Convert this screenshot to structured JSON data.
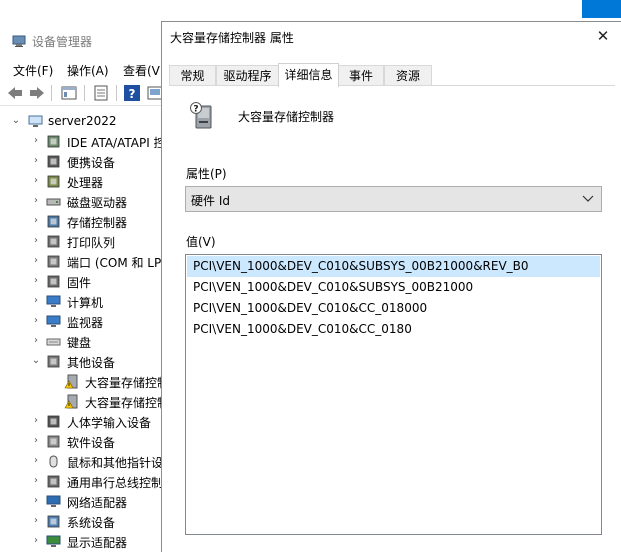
{
  "device_manager": {
    "title": "设备管理器",
    "menu": [
      "文件(F)",
      "操作(A)",
      "查看(V"
    ],
    "tree": {
      "root": "server2022",
      "items": [
        {
          "label": "IDE ATA/ATAPI 控",
          "icon": "ide-controller-icon",
          "expanded": false
        },
        {
          "label": "便携设备",
          "icon": "portable-device-icon",
          "expanded": false
        },
        {
          "label": "处理器",
          "icon": "processor-icon",
          "expanded": false
        },
        {
          "label": "磁盘驱动器",
          "icon": "disk-drive-icon",
          "expanded": false
        },
        {
          "label": "存储控制器",
          "icon": "storage-controller-icon",
          "expanded": false
        },
        {
          "label": "打印队列",
          "icon": "printer-icon",
          "expanded": false
        },
        {
          "label": "端口 (COM 和 LP",
          "icon": "port-icon",
          "expanded": false
        },
        {
          "label": "固件",
          "icon": "firmware-icon",
          "expanded": false
        },
        {
          "label": "计算机",
          "icon": "computer-icon",
          "expanded": false
        },
        {
          "label": "监视器",
          "icon": "monitor-icon",
          "expanded": false
        },
        {
          "label": "键盘",
          "icon": "keyboard-icon",
          "expanded": false
        },
        {
          "label": "其他设备",
          "icon": "other-devices-icon",
          "expanded": true
        },
        {
          "label": "大容量存储控制器",
          "icon": "warning-device-icon",
          "child": true
        },
        {
          "label": "大容量存储控制器",
          "icon": "warning-device-icon",
          "child": true
        },
        {
          "label": "人体学输入设备",
          "icon": "hid-icon",
          "expanded": false
        },
        {
          "label": "软件设备",
          "icon": "software-device-icon",
          "expanded": false
        },
        {
          "label": "鼠标和其他指针设",
          "icon": "mouse-icon",
          "expanded": false
        },
        {
          "label": "通用串行总线控制",
          "icon": "usb-icon",
          "expanded": false
        },
        {
          "label": "网络适配器",
          "icon": "network-adapter-icon",
          "expanded": false
        },
        {
          "label": "系统设备",
          "icon": "system-device-icon",
          "expanded": false
        },
        {
          "label": "显示适配器",
          "icon": "display-adapter-icon",
          "expanded": false
        }
      ]
    }
  },
  "dialog": {
    "title": "大容量存储控制器 属性",
    "close_icon": "close-icon",
    "tabs": [
      "常规",
      "驱动程序",
      "详细信息",
      "事件",
      "资源"
    ],
    "active_tab": "详细信息",
    "device_name": "大容量存储控制器",
    "property_label": "属性(P)",
    "property_value": "硬件 Id",
    "value_label": "值(V)",
    "values": [
      "PCI\\VEN_1000&DEV_C010&SUBSYS_00B21000&REV_B0",
      "PCI\\VEN_1000&DEV_C010&SUBSYS_00B21000",
      "PCI\\VEN_1000&DEV_C010&CC_018000",
      "PCI\\VEN_1000&DEV_C010&CC_0180"
    ],
    "selected_value_index": 0
  },
  "colors": {
    "accent": "#0078d7",
    "selection": "#cce8ff",
    "warning": "#f5c400"
  }
}
